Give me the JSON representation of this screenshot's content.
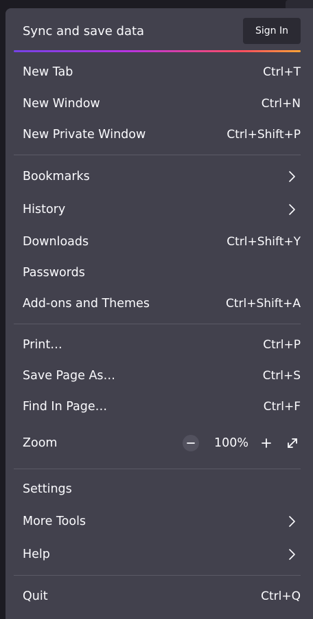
{
  "header": {
    "title": "Sync and save data",
    "sign_in_label": "Sign In"
  },
  "menu": {
    "new_tab": {
      "label": "New Tab",
      "shortcut": "Ctrl+T"
    },
    "new_window": {
      "label": "New Window",
      "shortcut": "Ctrl+N"
    },
    "new_private_window": {
      "label": "New Private Window",
      "shortcut": "Ctrl+Shift+P"
    },
    "bookmarks": {
      "label": "Bookmarks"
    },
    "history": {
      "label": "History"
    },
    "downloads": {
      "label": "Downloads",
      "shortcut": "Ctrl+Shift+Y"
    },
    "passwords": {
      "label": "Passwords"
    },
    "addons": {
      "label": "Add-ons and Themes",
      "shortcut": "Ctrl+Shift+A"
    },
    "print": {
      "label": "Print…",
      "shortcut": "Ctrl+P"
    },
    "save_page": {
      "label": "Save Page As…",
      "shortcut": "Ctrl+S"
    },
    "find": {
      "label": "Find In Page…",
      "shortcut": "Ctrl+F"
    },
    "zoom": {
      "label": "Zoom",
      "value": "100%"
    },
    "settings": {
      "label": "Settings"
    },
    "more_tools": {
      "label": "More Tools"
    },
    "help": {
      "label": "Help"
    },
    "quit": {
      "label": "Quit",
      "shortcut": "Ctrl+Q"
    }
  },
  "icons": [
    "chevron-right-icon",
    "zoom-out-icon",
    "zoom-in-icon",
    "fullscreen-icon"
  ],
  "colors": {
    "menu_bg": "#42414d",
    "accent_gradient": [
      "#7542e5",
      "#b833e1",
      "#ff4f5e",
      "#ffa436"
    ]
  }
}
